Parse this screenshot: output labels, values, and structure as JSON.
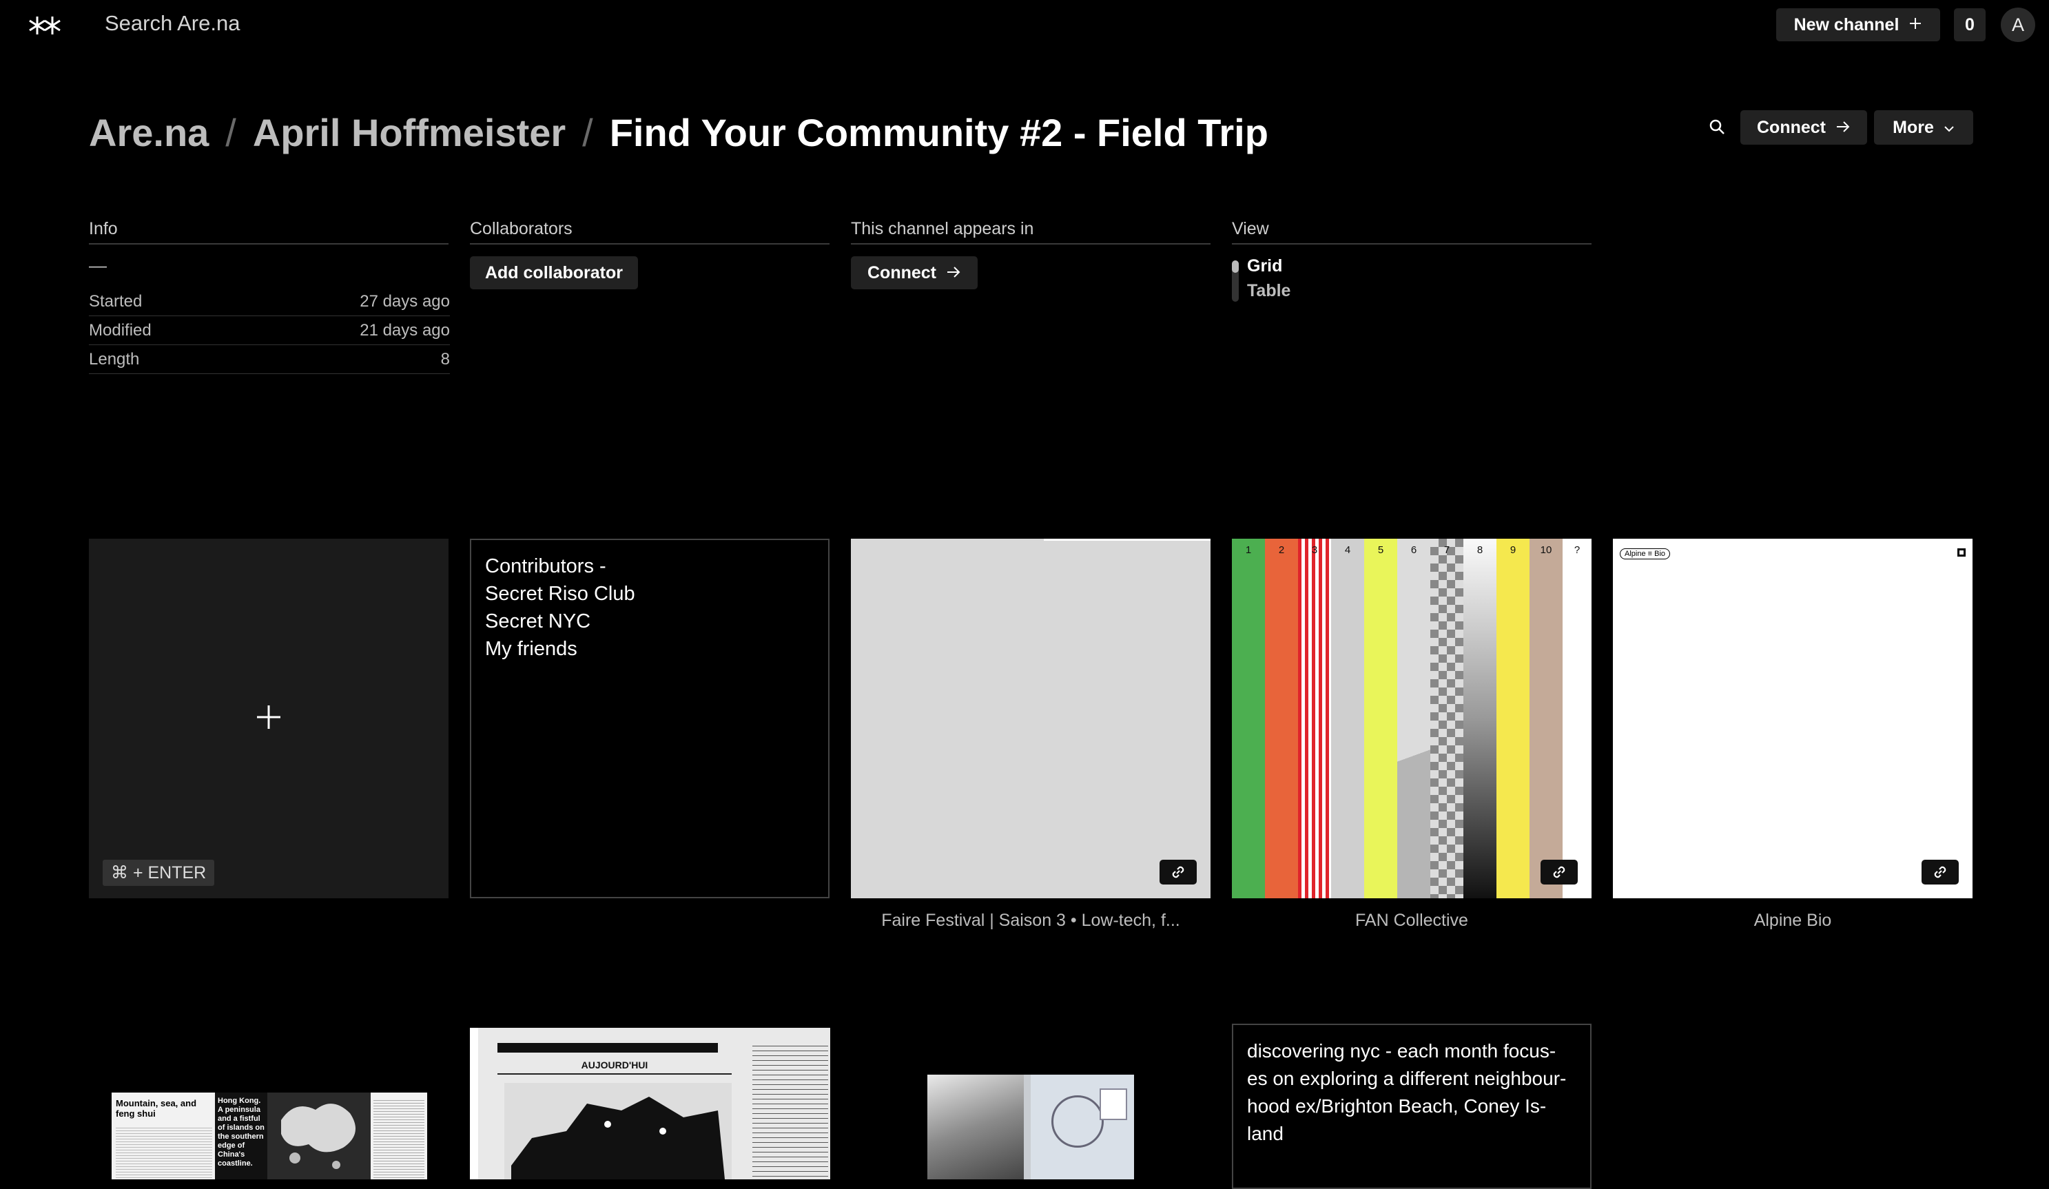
{
  "topbar": {
    "search_placeholder": "Search Are.na",
    "new_channel_label": "New channel",
    "notification_count": "0",
    "avatar_initial": "A"
  },
  "breadcrumb": {
    "root": "Are.na",
    "user": "April Hoffmeister",
    "channel": "Find Your Community #2 - Field Trip",
    "separator": "/"
  },
  "actions": {
    "connect_label": "Connect",
    "more_label": "More"
  },
  "info": {
    "heading": "Info",
    "description": "—",
    "rows": [
      {
        "label": "Started",
        "value": "27 days ago"
      },
      {
        "label": "Modified",
        "value": "21 days ago"
      },
      {
        "label": "Length",
        "value": "8"
      }
    ]
  },
  "collaborators": {
    "heading": "Collaborators",
    "add_label": "Add collaborator"
  },
  "appears_in": {
    "heading": "This channel appears in",
    "connect_label": "Connect"
  },
  "view": {
    "heading": "View",
    "options": [
      "Grid",
      "Table"
    ],
    "selected": "Grid"
  },
  "blocks": {
    "new_block_shortcut": "⌘ + ENTER",
    "text_block_1": "Contributors -\nSecret Riso Club\nSecret NYC\nMy friends",
    "caption_3": "Faire Festival | Saison 3 • Low-tech, f...",
    "caption_4": "FAN Collective",
    "caption_5": "Alpine Bio",
    "alpine_tag": "Alpine ≡ Bio",
    "fan_numbers": [
      "1",
      "2",
      "3",
      "4",
      "5",
      "6",
      "7",
      "8",
      "9",
      "10",
      "?"
    ],
    "text_block_2": "discovering nyc - each month focus-\nes on exploring a different neighbour-\nhood ex/Brighton Beach, Coney Is-\nland",
    "map_title": "Mountain, sea, and feng shui",
    "map_subtitle": "Hong Kong. A peninsula and a fistful of islands on the southern edge of China's coastline.",
    "news_banner": "AUJOURD'HUI"
  },
  "colors": {
    "background": "#000000",
    "button": "#222222",
    "fan_stripes": [
      "#4caf50",
      "#e8643a",
      "#e0242b",
      "#cfcfcf",
      "#e9f55a",
      "#d6d6d6",
      "#b9b9b9",
      "#efefef",
      "#f5e84e",
      "#c4aa98",
      "#ffffff"
    ]
  }
}
